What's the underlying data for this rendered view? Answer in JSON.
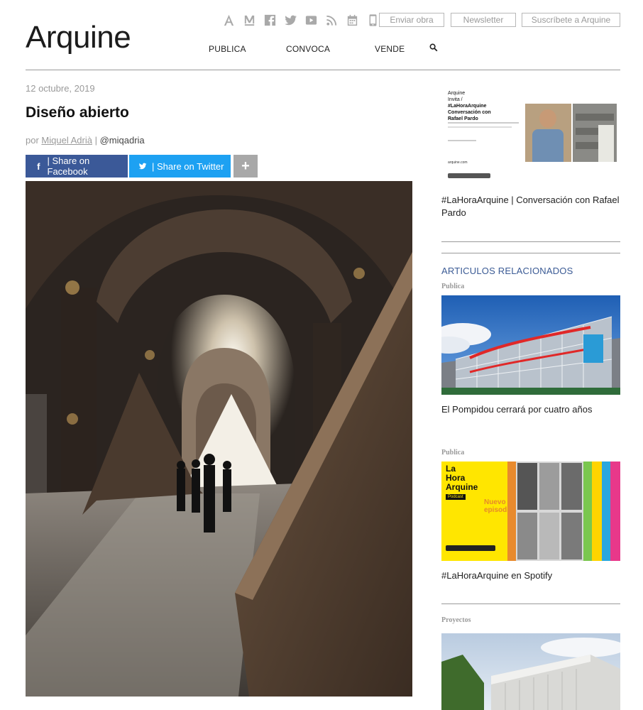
{
  "header": {
    "logo": "Arquine",
    "icons": [
      "arquine-a-icon",
      "arquine-m-icon",
      "facebook-icon",
      "twitter-icon",
      "youtube-icon",
      "rss-icon",
      "calendar-icon",
      "mobile-icon"
    ],
    "buttons": {
      "enviar": "Enviar obra",
      "newsletter": "Newsletter",
      "suscribete": "Suscríbete a Arquine"
    },
    "nav": {
      "publica": "PUBLICA",
      "convoca": "CONVOCA",
      "vende": "VENDE"
    }
  },
  "article": {
    "date": "12 octubre, 2019",
    "title": "Diseño abierto",
    "by_prefix": "por",
    "author": "Miquel Adrià",
    "separator": "|",
    "handle": "@miqadria",
    "share_facebook": "| Share on Facebook",
    "share_twitter": "| Share on Twitter",
    "share_more": "+"
  },
  "sidebar": {
    "promo": {
      "line1": "Arquine",
      "line2": "Invita /",
      "line3": "#LaHoraArquine",
      "line4": "Conversación con",
      "line5": "Rafael Pardo",
      "url": "arquine.com",
      "caption": "#LaHoraArquine | Conversación con Rafael Pardo"
    },
    "related_title": "ARTICULOS RELACIONADOS",
    "items": [
      {
        "category": "Publica",
        "caption": "El Pompidou cerrará por cuatro años"
      },
      {
        "category": "Publica",
        "caption": "#LaHoraArquine en Spotify",
        "img_title1": "La",
        "img_title2": "Hora",
        "img_title3": "Arquine",
        "img_badge": "Podcast",
        "img_new": "Nuevo",
        "img_ep": "episodio"
      },
      {
        "category": "Proyectos"
      }
    ]
  },
  "colors": {
    "facebook": "#3b5998",
    "twitter": "#1da1f2",
    "related": "#3b5b95",
    "podcast_yellow": "#ffe600"
  }
}
